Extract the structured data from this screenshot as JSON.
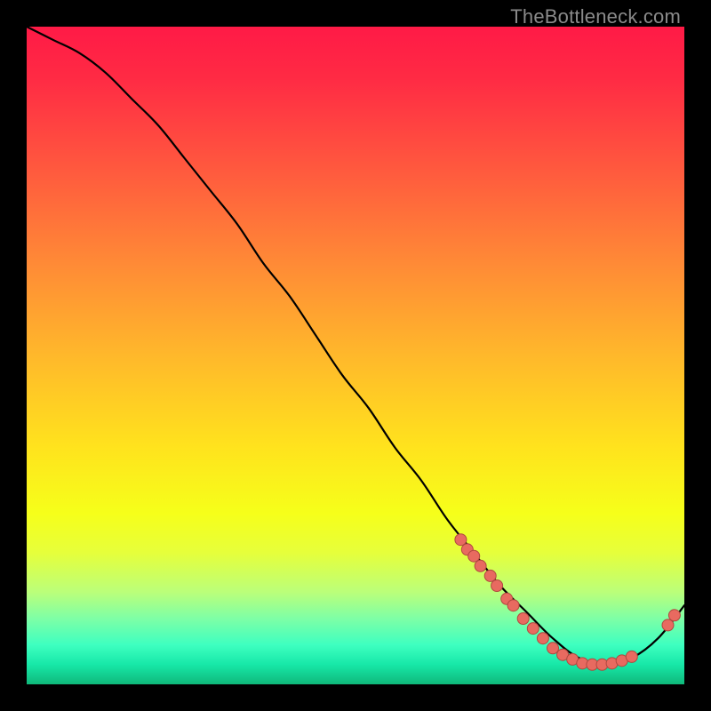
{
  "watermark": "TheBottleneck.com",
  "colors": {
    "background": "#000000",
    "curve_stroke": "#000000",
    "marker_fill": "#e86a60",
    "marker_stroke": "#b0483f"
  },
  "chart_data": {
    "type": "line",
    "title": "",
    "xlabel": "",
    "ylabel": "",
    "xlim": [
      0,
      100
    ],
    "ylim": [
      0,
      100
    ],
    "grid": false,
    "legend": false,
    "series": [
      {
        "name": "bottleneck-curve",
        "x": [
          0,
          4,
          8,
          12,
          16,
          20,
          24,
          28,
          32,
          36,
          40,
          44,
          48,
          52,
          56,
          60,
          64,
          68,
          72,
          76,
          80,
          84,
          88,
          92,
          96,
          100
        ],
        "y": [
          100,
          98,
          96,
          93,
          89,
          85,
          80,
          75,
          70,
          64,
          59,
          53,
          47,
          42,
          36,
          31,
          25,
          20,
          15,
          11,
          7,
          4,
          3,
          4,
          7,
          12
        ]
      }
    ],
    "markers": [
      {
        "x": 66,
        "y": 22
      },
      {
        "x": 67,
        "y": 20.5
      },
      {
        "x": 68,
        "y": 19.5
      },
      {
        "x": 69,
        "y": 18
      },
      {
        "x": 70.5,
        "y": 16.5
      },
      {
        "x": 71.5,
        "y": 15
      },
      {
        "x": 73,
        "y": 13
      },
      {
        "x": 74,
        "y": 12
      },
      {
        "x": 75.5,
        "y": 10
      },
      {
        "x": 77,
        "y": 8.5
      },
      {
        "x": 78.5,
        "y": 7
      },
      {
        "x": 80,
        "y": 5.5
      },
      {
        "x": 81.5,
        "y": 4.5
      },
      {
        "x": 83,
        "y": 3.8
      },
      {
        "x": 84.5,
        "y": 3.2
      },
      {
        "x": 86,
        "y": 3
      },
      {
        "x": 87.5,
        "y": 3
      },
      {
        "x": 89,
        "y": 3.2
      },
      {
        "x": 90.5,
        "y": 3.6
      },
      {
        "x": 92,
        "y": 4.2
      },
      {
        "x": 97.5,
        "y": 9
      },
      {
        "x": 98.5,
        "y": 10.5
      }
    ]
  }
}
